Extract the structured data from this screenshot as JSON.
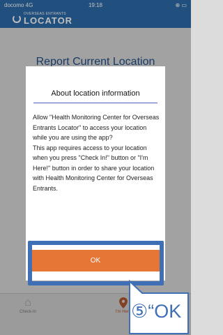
{
  "status_bar": {
    "carrier": "docomo  4G",
    "time": "19:18",
    "battery": "⊕ ▭"
  },
  "app_header": {
    "logo_small": "OVERSEAS ENTRANTS",
    "logo_big": "LOCATOR"
  },
  "page": {
    "title": "Report Current Location",
    "ghost_text": "I'm Here!"
  },
  "dialog": {
    "title": "About location information",
    "body": "Allow \"Health Monitoring Center for Overseas Entrants Locator\" to access your location while you are using the app?\nThis app requires access to your location when you press \"Check In!\" button or \"I'm Here!\" button in order to share your location with Health Monitoring Center for Overseas Entrants.",
    "ok_label": "OK"
  },
  "tabbar": {
    "items": [
      {
        "label": "Check-In",
        "icon": "home-icon"
      },
      {
        "label": "I'm Here",
        "icon": "location-pin-icon"
      }
    ]
  },
  "annotation": {
    "label": "⑤“OK"
  },
  "colors": {
    "primary": "#2d6aa8",
    "accent": "#e67636",
    "annotation": "#3f6fb5"
  }
}
